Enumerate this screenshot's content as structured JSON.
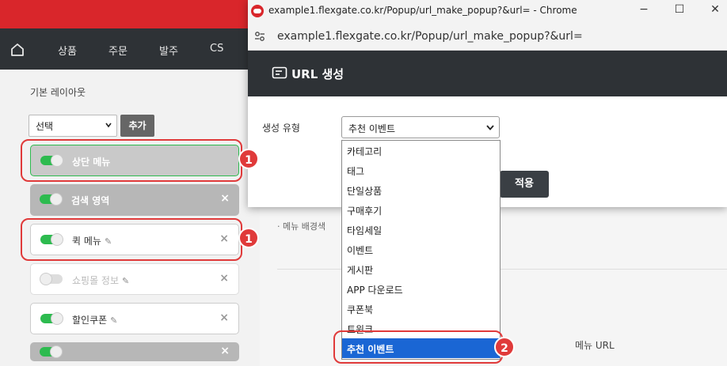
{
  "app": {
    "nav": {
      "home_icon": "home-icon",
      "items": [
        "상품",
        "주문",
        "발주",
        "CS"
      ]
    },
    "left_panel": {
      "section_title": "기본 레이아웃",
      "select_value": "선택",
      "add_button": "추가",
      "rows": [
        {
          "label": "상단 메뉴",
          "toggle_on": true,
          "close": ""
        },
        {
          "label": "검색 영역",
          "toggle_on": true,
          "close": "×"
        },
        {
          "label": "퀵 메뉴",
          "toggle_on": true,
          "close": "×",
          "editable": true
        },
        {
          "label": "쇼핑몰 정보",
          "toggle_on": false,
          "close": "×",
          "editable": true
        },
        {
          "label": "할인쿠폰",
          "toggle_on": true,
          "close": "×",
          "editable": true
        },
        {
          "label": "",
          "toggle_on": true,
          "close": "×"
        }
      ]
    },
    "main": {
      "menu_bg_label": "· 메뉴 배경색",
      "menu_url_header": "메뉴 URL"
    }
  },
  "popup": {
    "window_title": "example1.flexgate.co.kr/Popup/url_make_popup?&url= - Chrome",
    "address_url": "example1.flexgate.co.kr/Popup/url_make_popup?&url=",
    "window_controls": {
      "minimize": "−",
      "maximize": "☐",
      "close": "✕"
    },
    "header_title": "URL 생성",
    "field_label": "생성 유형",
    "select_value": "추천 이벤트",
    "apply_button": "적용",
    "dropdown_options": [
      "카테고리",
      "태그",
      "단일상품",
      "구매후기",
      "타임세일",
      "이벤트",
      "게시판",
      "APP 다운로드",
      "쿠폰북",
      "트윈크",
      "추천 이벤트"
    ],
    "selected_option": "추천 이벤트"
  },
  "annotations": {
    "badge_1": "1",
    "badge_2": "2"
  },
  "colors": {
    "brand_red": "#d9262b",
    "nav_dark": "#2e3236",
    "toggle_green": "#2dbb4f",
    "selection_blue": "#1a66d4",
    "annotation_red": "#e03a3a"
  }
}
